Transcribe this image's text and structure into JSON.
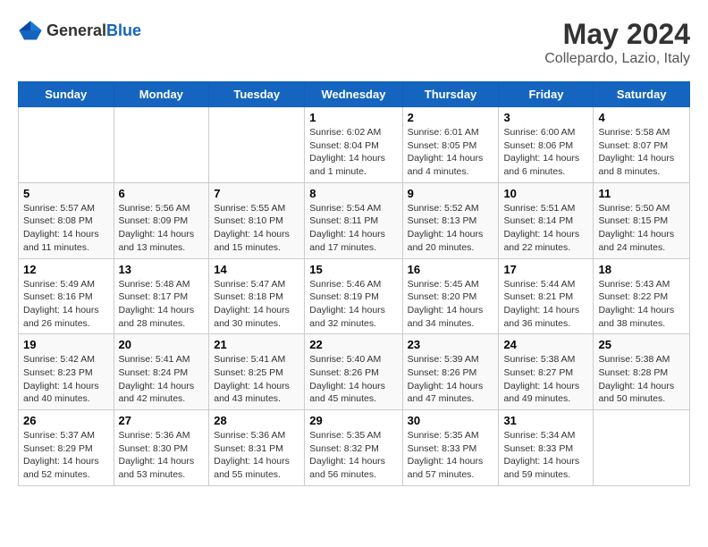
{
  "header": {
    "logo_general": "General",
    "logo_blue": "Blue",
    "title": "May 2024",
    "subtitle": "Collepardo, Lazio, Italy"
  },
  "days": [
    "Sunday",
    "Monday",
    "Tuesday",
    "Wednesday",
    "Thursday",
    "Friday",
    "Saturday"
  ],
  "weeks": [
    [
      {
        "day": "",
        "info": ""
      },
      {
        "day": "",
        "info": ""
      },
      {
        "day": "",
        "info": ""
      },
      {
        "day": "1",
        "info": "Sunrise: 6:02 AM\nSunset: 8:04 PM\nDaylight: 14 hours\nand 1 minute."
      },
      {
        "day": "2",
        "info": "Sunrise: 6:01 AM\nSunset: 8:05 PM\nDaylight: 14 hours\nand 4 minutes."
      },
      {
        "day": "3",
        "info": "Sunrise: 6:00 AM\nSunset: 8:06 PM\nDaylight: 14 hours\nand 6 minutes."
      },
      {
        "day": "4",
        "info": "Sunrise: 5:58 AM\nSunset: 8:07 PM\nDaylight: 14 hours\nand 8 minutes."
      }
    ],
    [
      {
        "day": "5",
        "info": "Sunrise: 5:57 AM\nSunset: 8:08 PM\nDaylight: 14 hours\nand 11 minutes."
      },
      {
        "day": "6",
        "info": "Sunrise: 5:56 AM\nSunset: 8:09 PM\nDaylight: 14 hours\nand 13 minutes."
      },
      {
        "day": "7",
        "info": "Sunrise: 5:55 AM\nSunset: 8:10 PM\nDaylight: 14 hours\nand 15 minutes."
      },
      {
        "day": "8",
        "info": "Sunrise: 5:54 AM\nSunset: 8:11 PM\nDaylight: 14 hours\nand 17 minutes."
      },
      {
        "day": "9",
        "info": "Sunrise: 5:52 AM\nSunset: 8:13 PM\nDaylight: 14 hours\nand 20 minutes."
      },
      {
        "day": "10",
        "info": "Sunrise: 5:51 AM\nSunset: 8:14 PM\nDaylight: 14 hours\nand 22 minutes."
      },
      {
        "day": "11",
        "info": "Sunrise: 5:50 AM\nSunset: 8:15 PM\nDaylight: 14 hours\nand 24 minutes."
      }
    ],
    [
      {
        "day": "12",
        "info": "Sunrise: 5:49 AM\nSunset: 8:16 PM\nDaylight: 14 hours\nand 26 minutes."
      },
      {
        "day": "13",
        "info": "Sunrise: 5:48 AM\nSunset: 8:17 PM\nDaylight: 14 hours\nand 28 minutes."
      },
      {
        "day": "14",
        "info": "Sunrise: 5:47 AM\nSunset: 8:18 PM\nDaylight: 14 hours\nand 30 minutes."
      },
      {
        "day": "15",
        "info": "Sunrise: 5:46 AM\nSunset: 8:19 PM\nDaylight: 14 hours\nand 32 minutes."
      },
      {
        "day": "16",
        "info": "Sunrise: 5:45 AM\nSunset: 8:20 PM\nDaylight: 14 hours\nand 34 minutes."
      },
      {
        "day": "17",
        "info": "Sunrise: 5:44 AM\nSunset: 8:21 PM\nDaylight: 14 hours\nand 36 minutes."
      },
      {
        "day": "18",
        "info": "Sunrise: 5:43 AM\nSunset: 8:22 PM\nDaylight: 14 hours\nand 38 minutes."
      }
    ],
    [
      {
        "day": "19",
        "info": "Sunrise: 5:42 AM\nSunset: 8:23 PM\nDaylight: 14 hours\nand 40 minutes."
      },
      {
        "day": "20",
        "info": "Sunrise: 5:41 AM\nSunset: 8:24 PM\nDaylight: 14 hours\nand 42 minutes."
      },
      {
        "day": "21",
        "info": "Sunrise: 5:41 AM\nSunset: 8:25 PM\nDaylight: 14 hours\nand 43 minutes."
      },
      {
        "day": "22",
        "info": "Sunrise: 5:40 AM\nSunset: 8:26 PM\nDaylight: 14 hours\nand 45 minutes."
      },
      {
        "day": "23",
        "info": "Sunrise: 5:39 AM\nSunset: 8:26 PM\nDaylight: 14 hours\nand 47 minutes."
      },
      {
        "day": "24",
        "info": "Sunrise: 5:38 AM\nSunset: 8:27 PM\nDaylight: 14 hours\nand 49 minutes."
      },
      {
        "day": "25",
        "info": "Sunrise: 5:38 AM\nSunset: 8:28 PM\nDaylight: 14 hours\nand 50 minutes."
      }
    ],
    [
      {
        "day": "26",
        "info": "Sunrise: 5:37 AM\nSunset: 8:29 PM\nDaylight: 14 hours\nand 52 minutes."
      },
      {
        "day": "27",
        "info": "Sunrise: 5:36 AM\nSunset: 8:30 PM\nDaylight: 14 hours\nand 53 minutes."
      },
      {
        "day": "28",
        "info": "Sunrise: 5:36 AM\nSunset: 8:31 PM\nDaylight: 14 hours\nand 55 minutes."
      },
      {
        "day": "29",
        "info": "Sunrise: 5:35 AM\nSunset: 8:32 PM\nDaylight: 14 hours\nand 56 minutes."
      },
      {
        "day": "30",
        "info": "Sunrise: 5:35 AM\nSunset: 8:33 PM\nDaylight: 14 hours\nand 57 minutes."
      },
      {
        "day": "31",
        "info": "Sunrise: 5:34 AM\nSunset: 8:33 PM\nDaylight: 14 hours\nand 59 minutes."
      },
      {
        "day": "",
        "info": ""
      }
    ]
  ]
}
